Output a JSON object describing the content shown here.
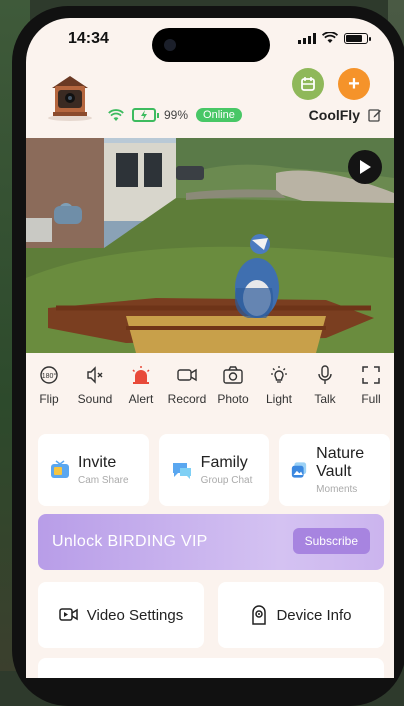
{
  "status_bar": {
    "time": "14:34"
  },
  "device": {
    "battery": "99%",
    "online": "Online",
    "name": "CoolFly"
  },
  "toolbar": [
    {
      "label": "Flip",
      "icon": "flip-180-icon"
    },
    {
      "label": "Sound",
      "icon": "speaker-mute-icon"
    },
    {
      "label": "Alert",
      "icon": "siren-icon"
    },
    {
      "label": "Record",
      "icon": "video-record-icon"
    },
    {
      "label": "Photo",
      "icon": "camera-icon"
    },
    {
      "label": "Light",
      "icon": "light-bulb-icon"
    },
    {
      "label": "Talk",
      "icon": "microphone-icon"
    },
    {
      "label": "Full",
      "icon": "fullscreen-icon"
    }
  ],
  "cards": [
    {
      "title": "Invite",
      "subtitle": "Cam Share"
    },
    {
      "title": "Family",
      "subtitle": "Group Chat"
    },
    {
      "title": "Nature Vault",
      "subtitle": "Moments"
    }
  ],
  "vip": {
    "title": "Unlock BIRDING VIP",
    "button": "Subscribe"
  },
  "buttons": {
    "video_settings": "Video Settings",
    "device_info": "Device Info"
  },
  "colors": {
    "online_green": "#48c766",
    "header_green": "#8fb85a",
    "header_orange": "#f5932a",
    "vip_purple": "#b89de8"
  }
}
